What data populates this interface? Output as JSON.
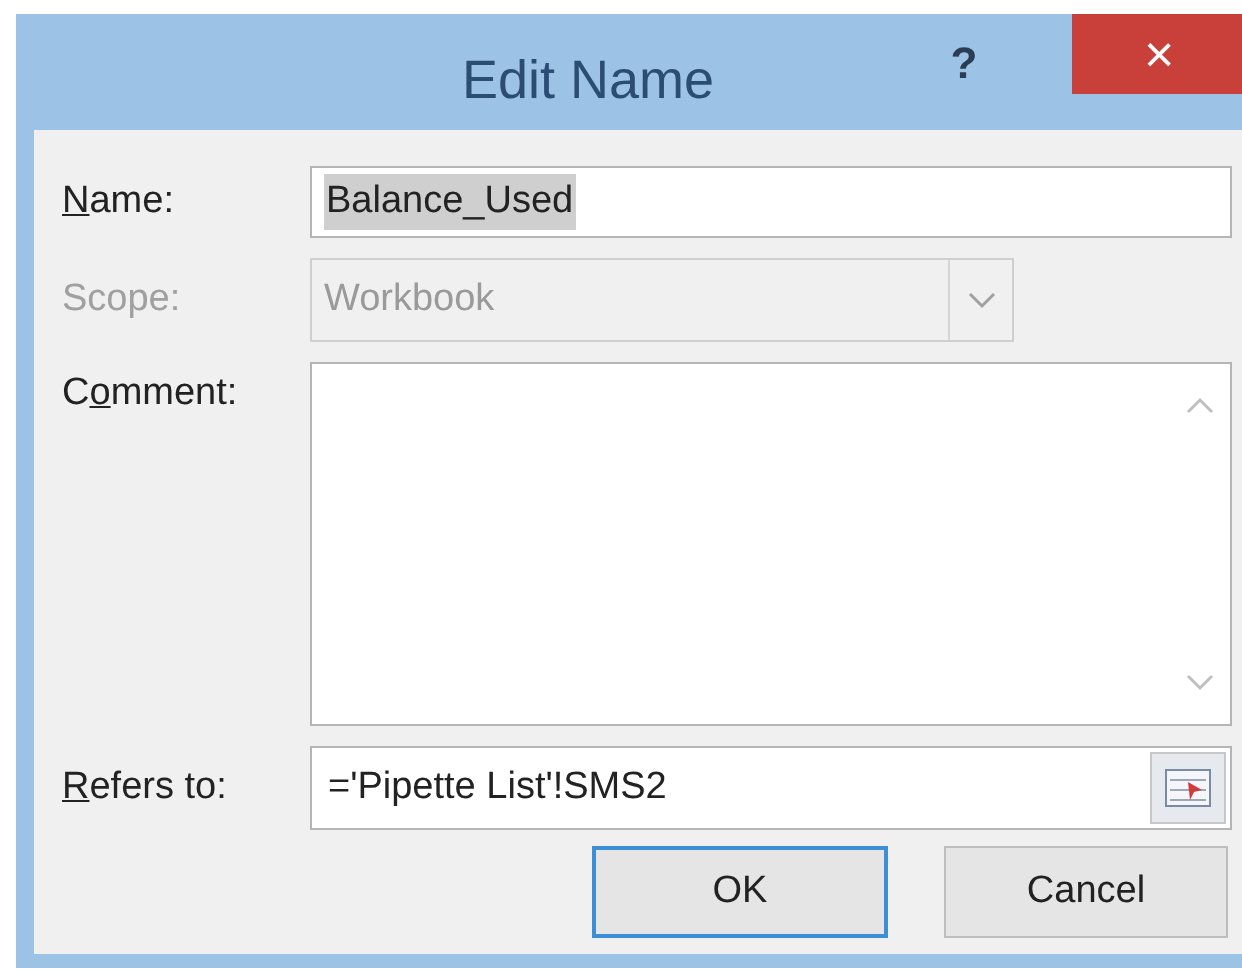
{
  "window": {
    "title": "Edit Name",
    "help": "?",
    "close": "×"
  },
  "fields": [
    {
      "kind": "text",
      "label": {
        "key": "N",
        "after": "ame:"
      },
      "value": "Balance_Used",
      "value_selected": true,
      "disabled": false
    },
    {
      "kind": "dropdown",
      "label": {
        "before": "Scope:"
      },
      "value": "Workbook",
      "disabled": true
    },
    {
      "kind": "textarea",
      "label": {
        "before": "C",
        "key": "o",
        "after": "mment:"
      },
      "disabled": false
    },
    {
      "kind": "reference",
      "label": {
        "key": "R",
        "after": "efers to:"
      },
      "value": "='Pipette List'!SMS2",
      "disabled": false
    }
  ],
  "buttons": [
    {
      "label": "OK",
      "default": true
    },
    {
      "label": "Cancel",
      "default": false
    }
  ]
}
